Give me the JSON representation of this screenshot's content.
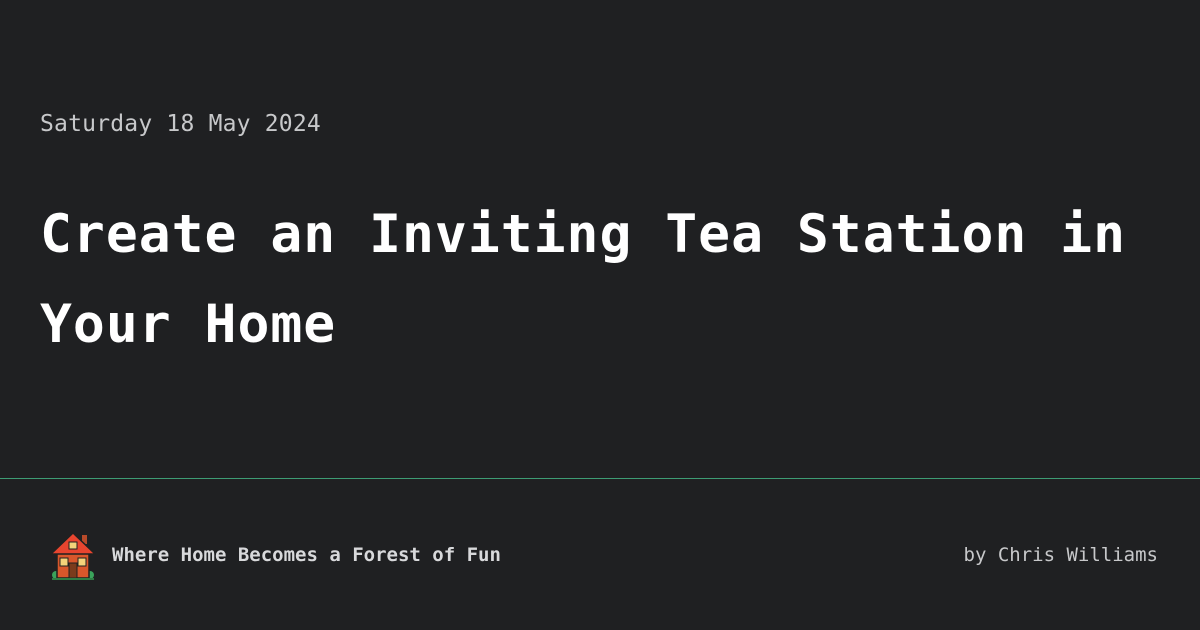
{
  "post": {
    "date": "Saturday 18 May 2024",
    "title": "Create an Inviting Tea Station in Your Home"
  },
  "footer": {
    "logo_icon": "house-icon",
    "tagline": "Where Home Becomes a Forest of Fun",
    "byline": "by Chris Williams"
  },
  "colors": {
    "background": "#1f2022",
    "divider": "#3d9c74",
    "text": "#ffffff",
    "muted_text": "#c7c8ca"
  }
}
